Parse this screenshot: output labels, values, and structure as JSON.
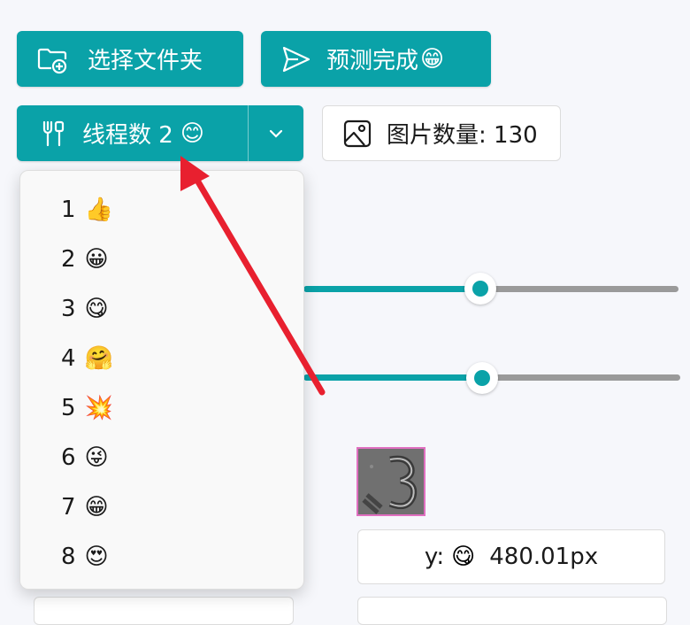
{
  "toolbar": {
    "select_folder": {
      "label": "选择文件夹",
      "icon": "folder-add-icon"
    },
    "predict": {
      "label": "预测完成",
      "emoji": "😁",
      "icon": "send-icon"
    },
    "threads": {
      "label": "线程数 2",
      "emoji": "😊",
      "icon": "tools-icon",
      "chevron": "chevron-down-icon"
    },
    "image_count": {
      "label": "图片数量: 130",
      "icon": "image-icon"
    }
  },
  "dropdown": {
    "options": [
      {
        "label": "1",
        "emoji": "👍"
      },
      {
        "label": "2",
        "emoji": "😀"
      },
      {
        "label": "3",
        "emoji": "😋"
      },
      {
        "label": "4",
        "emoji": "🤗"
      },
      {
        "label": "5",
        "emoji": "💥"
      },
      {
        "label": "6",
        "emoji": "😜"
      },
      {
        "label": "7",
        "emoji": "😁"
      },
      {
        "label": "8",
        "emoji": "😍"
      }
    ]
  },
  "sliders": [
    {
      "name": "slider-1",
      "fraction": 0.48
    },
    {
      "name": "slider-2",
      "fraction": 0.48
    }
  ],
  "coords": {
    "label": "y:",
    "emoji": "😋",
    "value": "480.01px"
  },
  "colors": {
    "accent": "#0aa2a8",
    "track": "#9a9a9a",
    "arrow": "#e8202f",
    "highlight": "#e06fc0"
  }
}
